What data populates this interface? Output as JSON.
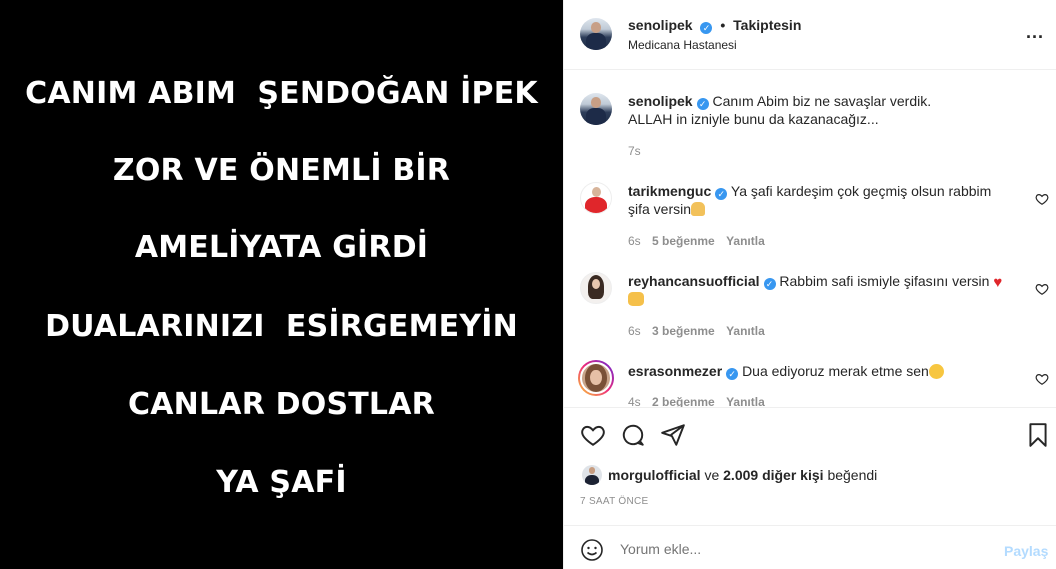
{
  "post_image": {
    "lines": [
      "CANIM ABIM  ŞENDOĞAN İPEK",
      "ZOR VE ÖNEMLİ BİR",
      "AMELİYATA GİRDİ",
      "DUALARINIZI  ESİRGEMEYİN",
      "CANLAR DOSTLAR",
      "YA ŞAFİ"
    ]
  },
  "header": {
    "username": "senolipek",
    "separator": "•",
    "follow_status": "Takiptesin",
    "location": "Medicana Hastanesi",
    "more_label": "..."
  },
  "caption": {
    "username": "senolipek",
    "line1": "Canım Abim biz ne savaşlar verdik.",
    "line2": "ALLAH in izniyle bunu da kazanacağız...",
    "time": "7s"
  },
  "comments": [
    {
      "username": "tarikmenguc",
      "line1": "Ya şafi kardeşim çok geçmiş olsun rabbim",
      "line2": "şifa versin",
      "time": "6s",
      "likes": "5 beğenme",
      "reply": "Yanıtla"
    },
    {
      "username": "reyhancansuofficial",
      "line1": "Rabbim safi ismiyle şifasını versin",
      "time": "6s",
      "likes": "3 beğenme",
      "reply": "Yanıtla"
    },
    {
      "username": "esrasonmezer",
      "line1": "Dua ediyoruz merak etme sen",
      "time": "4s",
      "likes": "2 beğenme",
      "reply": "Yanıtla"
    }
  ],
  "likes_line": {
    "user": "morgulofficial",
    "middle": "ve",
    "others": "2.009 diğer kişi",
    "suffix": "beğendi"
  },
  "timestamp": "7 SAAT ÖNCE",
  "composer": {
    "placeholder": "Yorum ekle...",
    "share_label": "Paylaş"
  },
  "colors": {
    "verified": "#3897f0",
    "share_disabled": "#b3dbff",
    "muted_text": "#8e8e8e"
  }
}
